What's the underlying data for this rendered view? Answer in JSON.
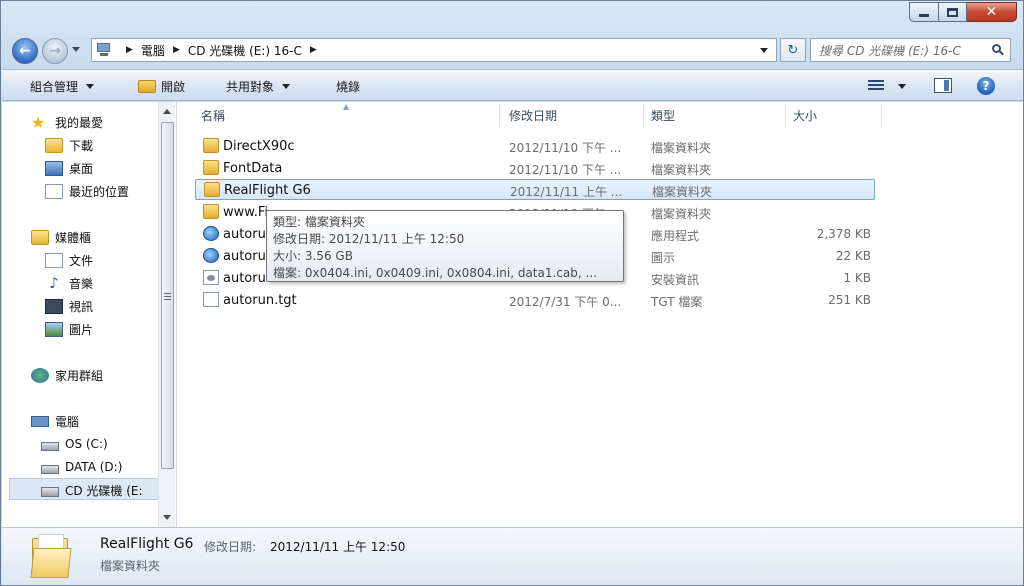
{
  "window": {
    "controls": {
      "minimize": "minimize-icon",
      "maximize": "maximize-icon",
      "close": "✕"
    }
  },
  "address": {
    "crumbs": [
      "電腦",
      "CD 光碟機 (E:) 16-C"
    ],
    "refresh_icon": "↻",
    "search_placeholder": "搜尋 CD 光碟機 (E:) 16-C"
  },
  "toolbar": {
    "organize": "組合管理",
    "open": "開啟",
    "share": "共用對象",
    "burn": "燒錄",
    "help": "?"
  },
  "nav": {
    "favorites": {
      "label": "我的最愛",
      "items": [
        "下載",
        "桌面",
        "最近的位置"
      ]
    },
    "libraries": {
      "label": "媒體櫃",
      "items": [
        "文件",
        "音樂",
        "視訊",
        "圖片"
      ]
    },
    "homegroup": "家用群組",
    "computer": {
      "label": "電腦",
      "items": [
        "OS (C:)",
        "DATA (D:)",
        "CD 光碟機 (E:"
      ]
    }
  },
  "columns": {
    "name": "名稱",
    "date": "修改日期",
    "type": "類型",
    "size": "大小"
  },
  "files": [
    {
      "name": "DirectX90c",
      "date": "2012/11/10 下午 ...",
      "type": "檔案資料夾",
      "size": "",
      "icon": "folder"
    },
    {
      "name": "FontData",
      "date": "2012/11/10 下午 ...",
      "type": "檔案資料夾",
      "size": "",
      "icon": "folder"
    },
    {
      "name": "RealFlight G6",
      "date": "2012/11/11 上午 ...",
      "type": "檔案資料夾",
      "size": "",
      "icon": "folder"
    },
    {
      "name": "www.Fi...",
      "date": "2012/11/10 下午 ...",
      "type": "檔案資料夾",
      "size": "",
      "icon": "folder"
    },
    {
      "name": "autoru",
      "date": "",
      "type": "應用程式",
      "size": "2,378 KB",
      "icon": "app"
    },
    {
      "name": "autoru",
      "date": "",
      "type": "圖示",
      "size": "22 KB",
      "icon": "iconfile"
    },
    {
      "name": "autoru",
      "date": "",
      "type": "安裝資訊",
      "size": "1 KB",
      "icon": "ini"
    },
    {
      "name": "autorun.tgt",
      "date": "2012/7/31 下午 0...",
      "type": "TGT 檔案",
      "size": "251 KB",
      "icon": "plain"
    }
  ],
  "tooltip": {
    "type": "類型: 檔案資料夾",
    "date": "修改日期: 2012/11/11 上午 12:50",
    "size": "大小: 3.56 GB",
    "files": "檔案: 0x0404.ini, 0x0409.ini, 0x0804.ini, data1.cab, ..."
  },
  "details": {
    "name": "RealFlight G6",
    "date_label": "修改日期:",
    "date": "2012/11/11 上午 12:50",
    "type": "檔案資料夾"
  }
}
